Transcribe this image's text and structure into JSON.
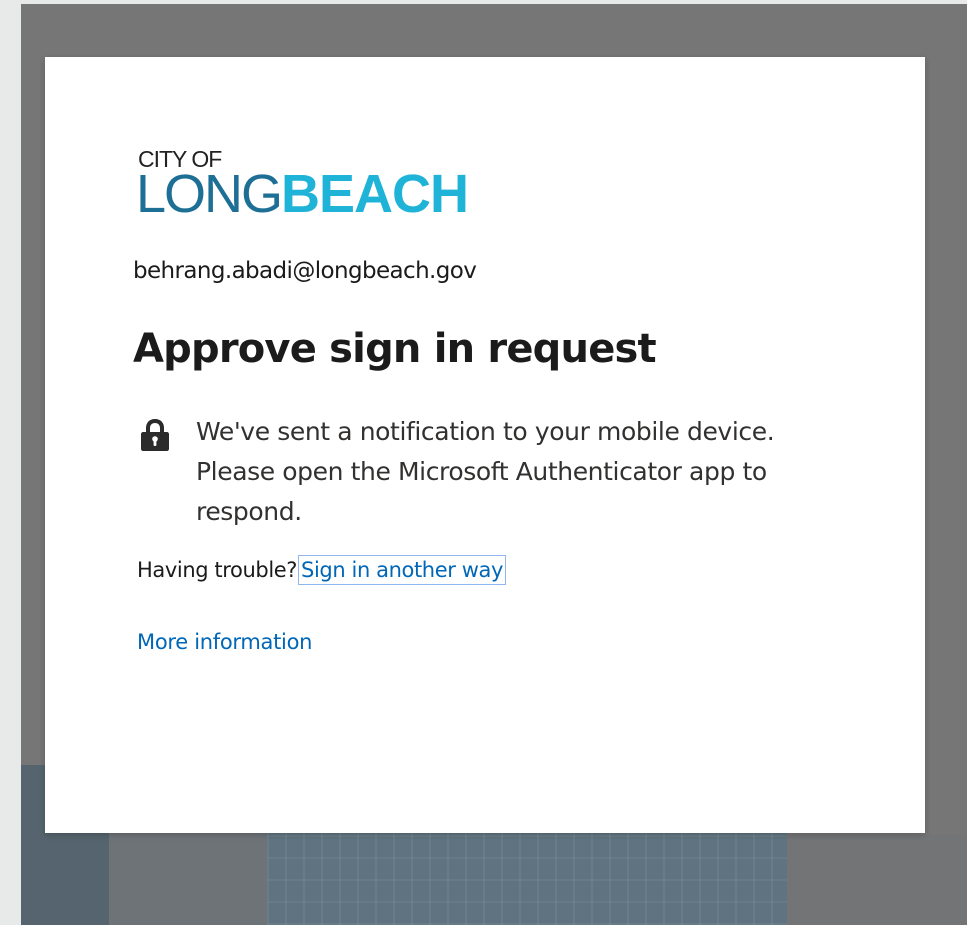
{
  "logo": {
    "line1": "CITY OF",
    "long": "LONG",
    "beach": "BEACH"
  },
  "identity": {
    "email": "behrang.abadi@longbeach.gov"
  },
  "title": "Approve sign in request",
  "notice": {
    "icon": "lock-icon",
    "text": "We've sent a notification to your mobile device. Please open the Microsoft Authenticator app to respond."
  },
  "trouble": {
    "prefix": "Having trouble?",
    "link": "Sign in another way"
  },
  "more_info": "More information",
  "colors": {
    "link": "#0067b8",
    "logo_long": "#1e6f96",
    "logo_beach": "#1fb3d7",
    "backdrop": "#767676"
  }
}
